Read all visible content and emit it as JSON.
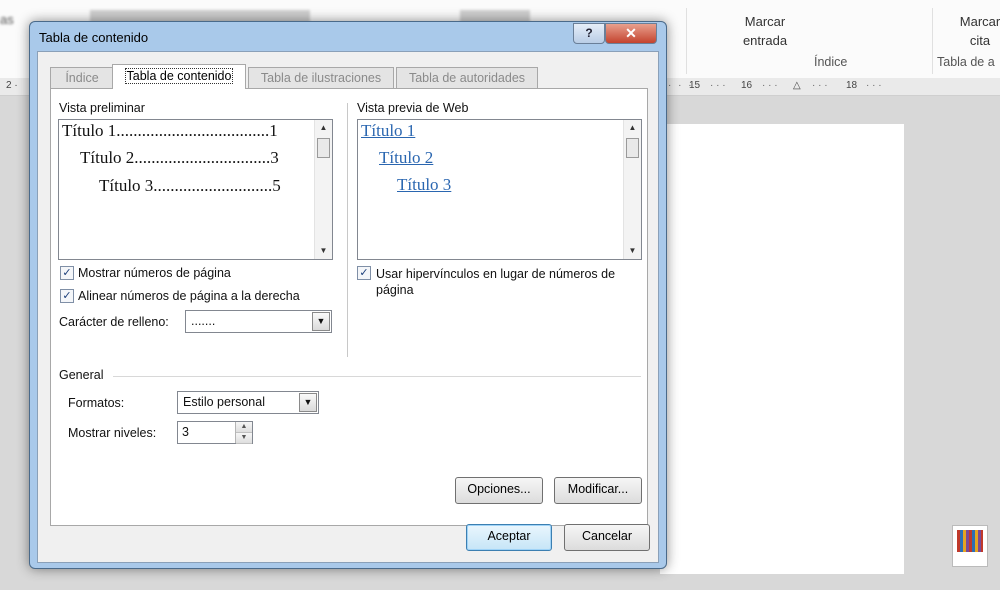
{
  "background": {
    "ribbon": {
      "marcar_entrada": "Marcar\nentrada",
      "indice_group": "Índice",
      "marcar_cita": "Marcar\ncita",
      "tabla_autoridades_group": "Tabla de a",
      "left_fragment": "as"
    },
    "ruler": {
      "left": "2 ·",
      "t15": "15",
      "t16": "16",
      "t18": "18"
    }
  },
  "dialog": {
    "title": "Tabla de contenido",
    "help_glyph": "?",
    "close_glyph": "✕",
    "tabs": [
      {
        "label": "Índice"
      },
      {
        "label": "Tabla de contenido"
      },
      {
        "label": "Tabla de ilustraciones"
      },
      {
        "label": "Tabla de autoridades"
      }
    ],
    "preview": {
      "label": "Vista preliminar",
      "entries": [
        {
          "text": "Título 1....................................1"
        },
        {
          "text": "Título 2................................3"
        },
        {
          "text": "Título 3............................5"
        }
      ]
    },
    "web_preview": {
      "label": "Vista previa de Web",
      "links": [
        "Título 1",
        "Título 2",
        "Título 3"
      ]
    },
    "options": {
      "show_page_numbers": {
        "label": "Mostrar números de página",
        "checked": true
      },
      "align_right": {
        "label": "Alinear números de página a la derecha",
        "checked": true
      },
      "use_hyperlinks": {
        "label": "Usar hipervínculos en lugar de números de página",
        "checked": true
      },
      "tab_leader": {
        "label": "Carácter de relleno:",
        "value": "......."
      }
    },
    "general": {
      "label": "General",
      "formats": {
        "label": "Formatos:",
        "value": "Estilo personal"
      },
      "levels": {
        "label": "Mostrar niveles:",
        "value": "3"
      }
    },
    "buttons": {
      "options": "Opciones...",
      "modify": "Modificar...",
      "ok": "Aceptar",
      "cancel": "Cancelar"
    },
    "check_glyph": "✓"
  },
  "colors": {
    "dialog_frame": "#a9c9ea",
    "link_blue": "#2a66b0",
    "close_red": "#c4432e"
  }
}
